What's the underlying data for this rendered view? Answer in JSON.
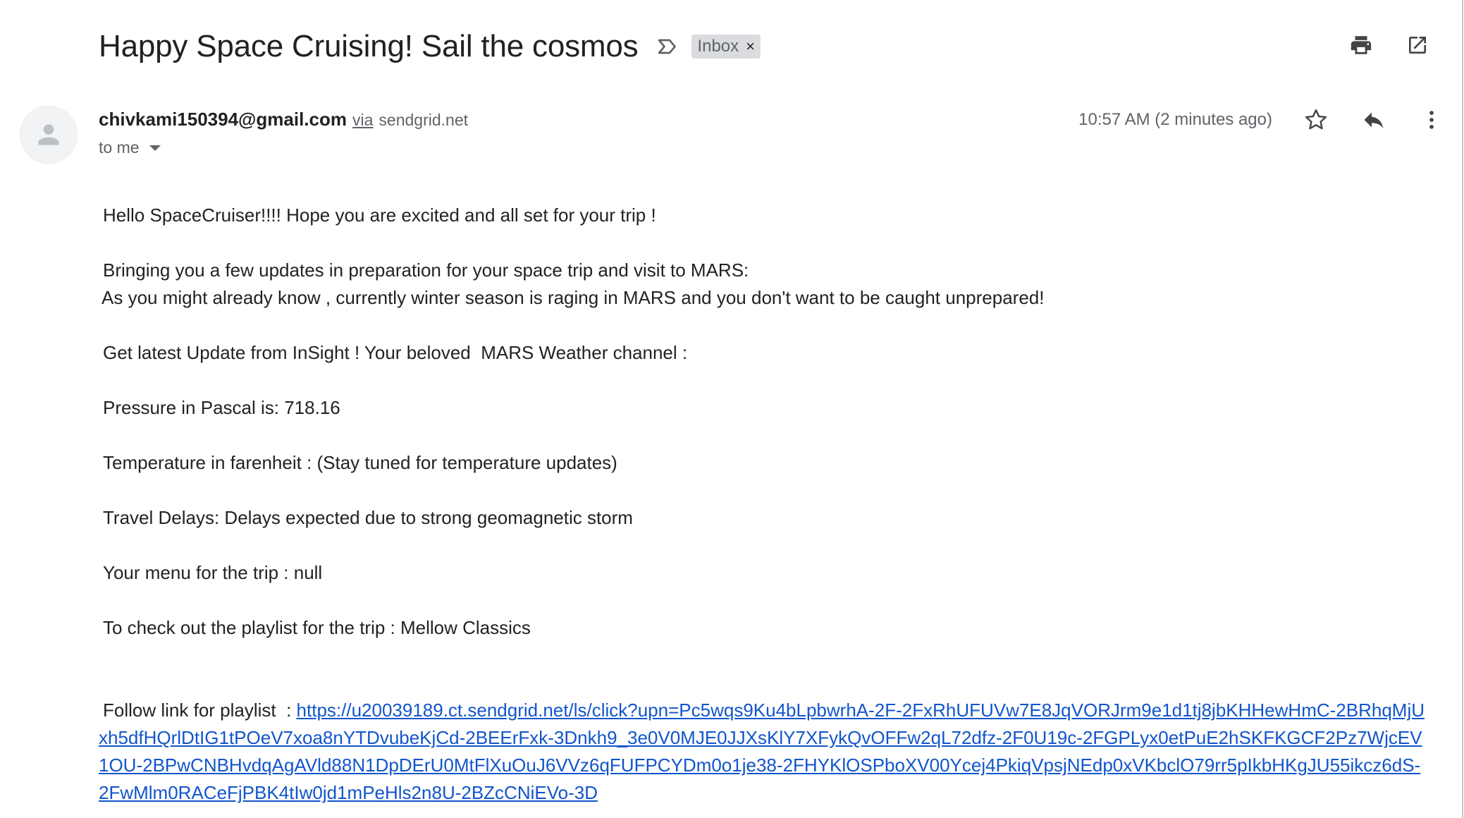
{
  "subject": {
    "title": "Happy Space Cruising! Sail the cosmos",
    "label": "Inbox",
    "label_remove": "×"
  },
  "sender": {
    "email": "chivkami150394@gmail.com",
    "via": "via",
    "via_domain": "sendgrid.net",
    "to": "to me",
    "timestamp": "10:57 AM (2 minutes ago)"
  },
  "icons": {
    "important": "important-marker-icon",
    "print": "print-icon",
    "open_new_window": "open-in-new-window-icon",
    "star": "star-icon",
    "reply": "reply-icon",
    "more": "more-vert-icon",
    "avatar": "person-avatar-icon"
  },
  "body": {
    "greeting": "Hello SpaceCruiser!!!! Hope you are excited and all set for your trip !",
    "updates_intro": "Bringing you a few updates in preparation for your space trip and visit to MARS:",
    "winter_note": "As you might already know , currently winter season is raging in MARS and you don't want to be caught unprepared!",
    "weather_channel": "Get latest Update from InSight ! Your beloved  MARS Weather channel :",
    "pressure": "Pressure in Pascal is: 718.16",
    "temperature": "Temperature in farenheit : (Stay tuned for temperature updates)",
    "delays": "Travel Delays: Delays expected due to strong geomagnetic storm",
    "menu": "Your menu for the trip : null",
    "playlist": "To check out the playlist for the trip : Mellow Classics",
    "follow_label": "Follow link for playlist  : ",
    "follow_url": "https://u20039189.ct.sendgrid.net/ls/click?upn=Pc5wqs9Ku4bLpbwrhA-2F-2FxRhUFUVw7E8JqVORJrm9e1d1tj8jbKHHewHmC-2BRhqMjUxh5dfHQrlDtIG1tPOeV7xoa8nYTDvubeKjCd-2BEErFxk-3Dnkh9_3e0V0MJE0JJXsKlY7XFykQvOFFw2qL72dfz-2F0U19c-2FGPLyx0etPuE2hSKFKGCF2Pz7WjcEV1OU-2BPwCNBHvdqAgAVld88N1DpDErU0MtFlXuOuJ6VVz6qFUFPCYDm0o1je38-2FHYKlOSPboXV00Ycej4PkiqVpsjNEdp0xVKbclO79rr5pIkbHKgJU55ikcz6dS-2FwMlm0RACeFjPBK4tIw0jd1mPeHls2n8U-2BZcCNiEVo-3D"
  }
}
